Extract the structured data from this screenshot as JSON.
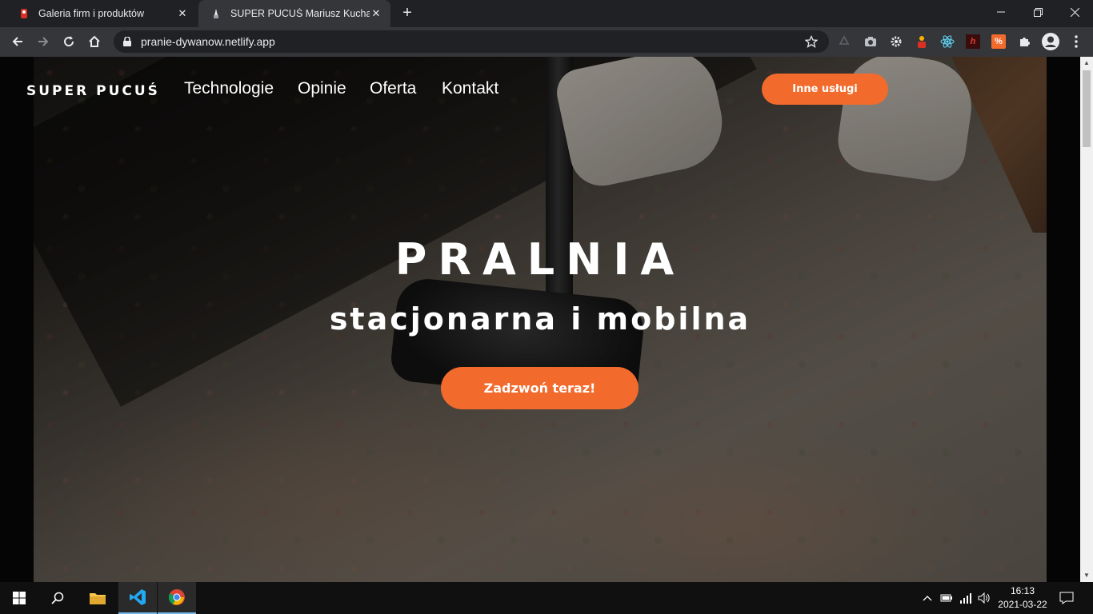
{
  "browser": {
    "tabs": [
      {
        "title": "Galeria firm i produktów",
        "active": false
      },
      {
        "title": "SUPER PUCUŚ Mariusz Kucharski",
        "active": true
      }
    ],
    "url": "pranie-dywanow.netlify.app",
    "new_tab_label": "+"
  },
  "site": {
    "brand": "SUPER PUCUŚ",
    "nav": [
      "Technologie",
      "Opinie",
      "Oferta",
      "Kontakt"
    ],
    "other_services_label": "Inne usługi",
    "hero_title": "PRALNIA",
    "hero_subtitle": "stacjonarna i mobilna",
    "cta_label": "Zadzwoń teraz!",
    "accent_color": "#f26a2c"
  },
  "taskbar": {
    "time": "16:13",
    "date": "2021-03-22",
    "pinned": [
      "windows-start",
      "search",
      "file-explorer",
      "visual-studio-code",
      "google-chrome"
    ]
  }
}
